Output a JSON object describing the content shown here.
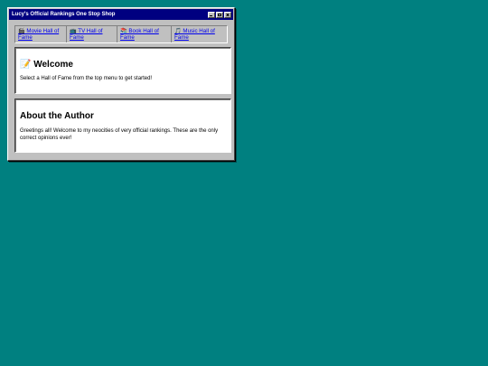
{
  "window": {
    "title": "Lucy's Official Rankings One Stop Shop"
  },
  "nav": {
    "items": [
      {
        "label": "🎬 Movie Hall of Fame"
      },
      {
        "label": "📺 TV Hall of Fame"
      },
      {
        "label": "📚 Book Hall of Fame"
      },
      {
        "label": "🎵 Music Hall of Fame"
      }
    ]
  },
  "welcome": {
    "title": "📝 Welcome",
    "text": "Select a Hall of Fame from the top menu to get started!"
  },
  "about": {
    "title": "About the Author",
    "text": "Greetings all! Welcome to my neocities of very official rankings. These are the only correct opinions ever!"
  },
  "colors": {
    "desktop": "#008080",
    "titlebar": "#000080",
    "window": "#c0c0c0",
    "link": "#0000ee"
  }
}
